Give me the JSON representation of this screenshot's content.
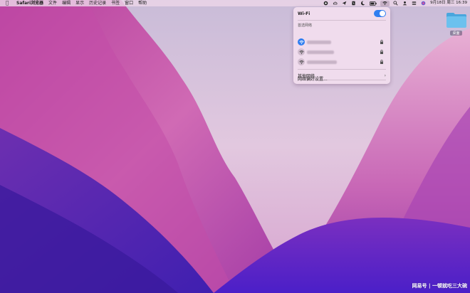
{
  "menubar": {
    "apple_icon": "apple-logo-icon",
    "app_name": "Safari浏览器",
    "menus": [
      "文件",
      "编辑",
      "显示",
      "历史记录",
      "书签",
      "窗口",
      "帮助"
    ],
    "status_icons": [
      "app-icon-1",
      "cloud-icon",
      "send-icon",
      "cut-icon",
      "moon-icon",
      "battery-icon",
      "wifi-icon",
      "search-icon",
      "user-icon",
      "control-center-icon",
      "siri-icon"
    ],
    "clock": "9月18日 周三  16:39"
  },
  "wifi_panel": {
    "title": "Wi-Fi",
    "toggle_on": true,
    "preferred_label": "首选网络",
    "networks": [
      {
        "connected": true,
        "locked": true
      },
      {
        "connected": false,
        "locked": true
      },
      {
        "connected": false,
        "locked": true
      }
    ],
    "other_networks_label": "其他网络",
    "preferences_label": "网络偏好设置..."
  },
  "desktop": {
    "folder_label": "桌面"
  },
  "watermark": {
    "text": "网易号 | 一顿就吃三大碗"
  },
  "colors": {
    "accent": "#2f7ef0",
    "menubar_bg": "#ecd6e8",
    "folder": "#6cc1ee"
  }
}
